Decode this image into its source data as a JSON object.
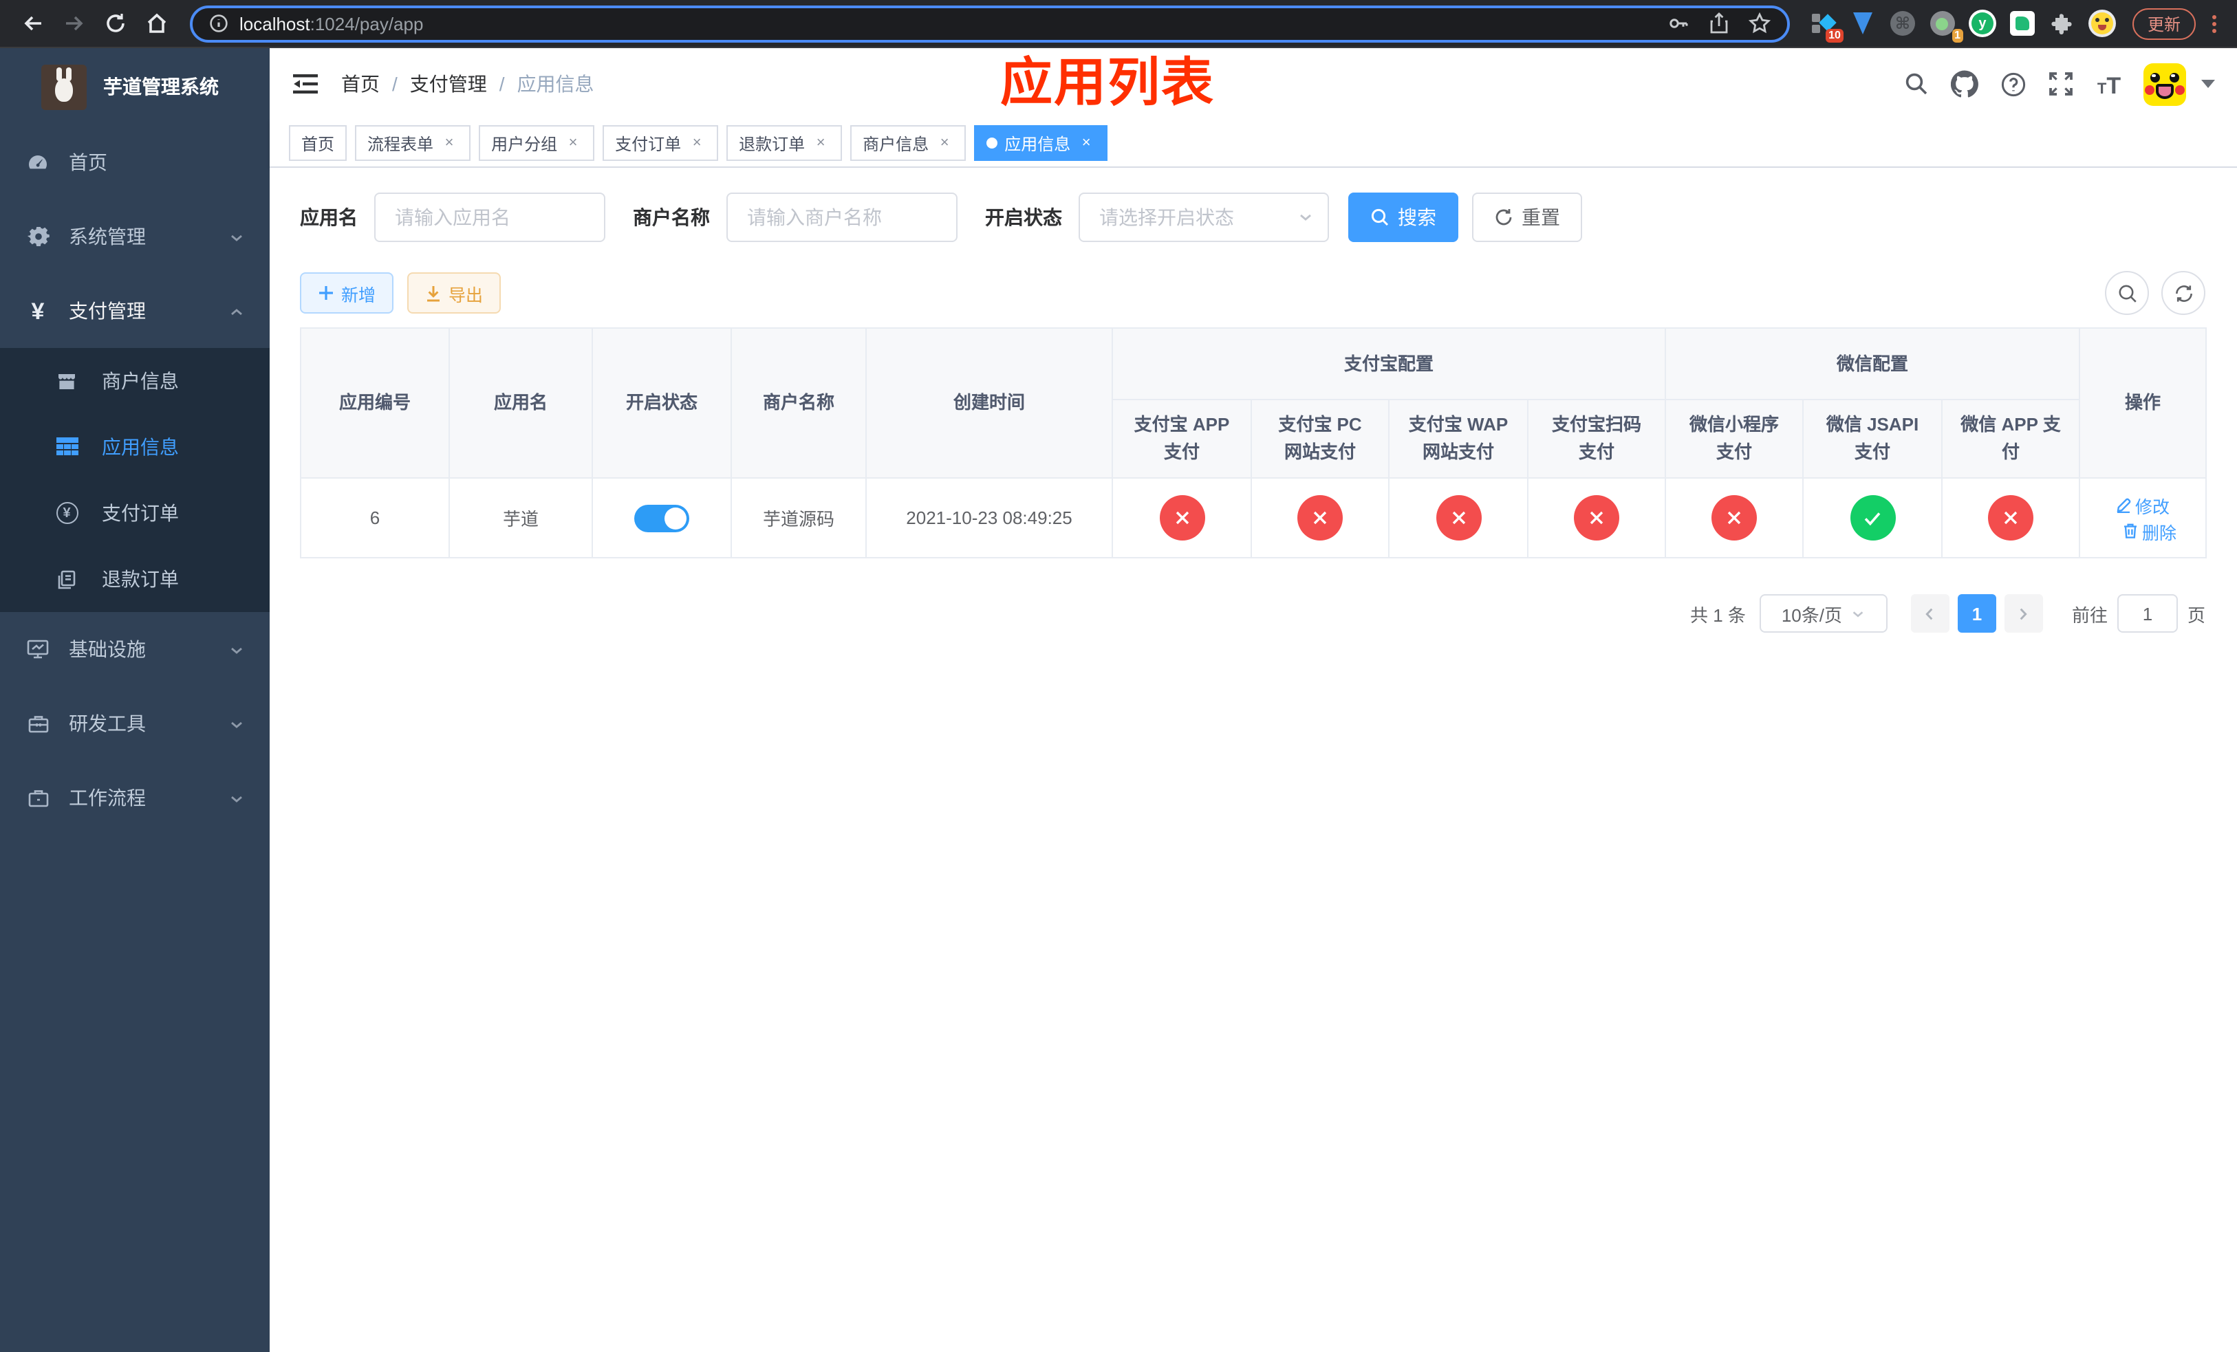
{
  "colors": {
    "accent": "#409eff",
    "success_green": "#13ce66",
    "danger_red": "#f34d4d",
    "warning_orange": "#e6a23c",
    "annotation_red": "#ff2f00",
    "sidebar_bg": "#304156",
    "submenu_bg": "#1f2d3d"
  },
  "browser": {
    "url_host": "localhost",
    "url_path": ":1024/pay/app",
    "update_button": "更新",
    "ext_badge_monkey": "10",
    "ext_badge_camera": "1",
    "ext_letter": "y"
  },
  "sidebar": {
    "title": "芋道管理系统",
    "items": [
      {
        "label": "首页"
      },
      {
        "label": "系统管理"
      },
      {
        "label": "支付管理",
        "children": [
          {
            "label": "商户信息"
          },
          {
            "label": "应用信息"
          },
          {
            "label": "支付订单"
          },
          {
            "label": "退款订单"
          }
        ]
      },
      {
        "label": "基础设施"
      },
      {
        "label": "研发工具"
      },
      {
        "label": "工作流程"
      }
    ]
  },
  "navbar": {
    "breadcrumb": [
      "首页",
      "支付管理",
      "应用信息"
    ],
    "separator": "/",
    "annotation": "应用列表"
  },
  "tabs": [
    {
      "label": "首页"
    },
    {
      "label": "流程表单"
    },
    {
      "label": "用户分组"
    },
    {
      "label": "支付订单"
    },
    {
      "label": "退款订单"
    },
    {
      "label": "商户信息"
    },
    {
      "label": "应用信息"
    }
  ],
  "filters": {
    "app_name_label": "应用名",
    "app_name_placeholder": "请输入应用名",
    "merchant_label": "商户名称",
    "merchant_placeholder": "请输入商户名称",
    "status_label": "开启状态",
    "status_placeholder": "请选择开启状态",
    "search_button": "搜索",
    "reset_button": "重置"
  },
  "toolbar": {
    "add_button": "新增",
    "export_button": "导出"
  },
  "table": {
    "group_alipay": "支付宝配置",
    "group_wechat": "微信配置",
    "columns": [
      "应用编号",
      "应用名",
      "开启状态",
      "商户名称",
      "创建时间",
      "支付宝 APP 支付",
      "支付宝 PC 网站支付",
      "支付宝 WAP 网站支付",
      "支付宝扫码支付",
      "微信小程序支付",
      "微信 JSAPI 支付",
      "微信 APP 支付",
      "操作"
    ],
    "row": {
      "id": "6",
      "name": "芋道",
      "enabled": true,
      "merchant": "芋道源码",
      "created_at": "2021-10-23 08:49:25",
      "statuses": [
        "fail",
        "fail",
        "fail",
        "fail",
        "fail",
        "pass",
        "fail"
      ],
      "edit_link": "修改",
      "delete_link": "删除"
    }
  },
  "pagination": {
    "total_text": "共 1 条",
    "page_size": "10条/页",
    "page": "1",
    "goto_label": "前往",
    "goto_value": "1",
    "page_unit": "页"
  },
  "icons": {
    "yen": "¥",
    "question": "?",
    "info": "i",
    "close": "×",
    "command": "⌘"
  }
}
